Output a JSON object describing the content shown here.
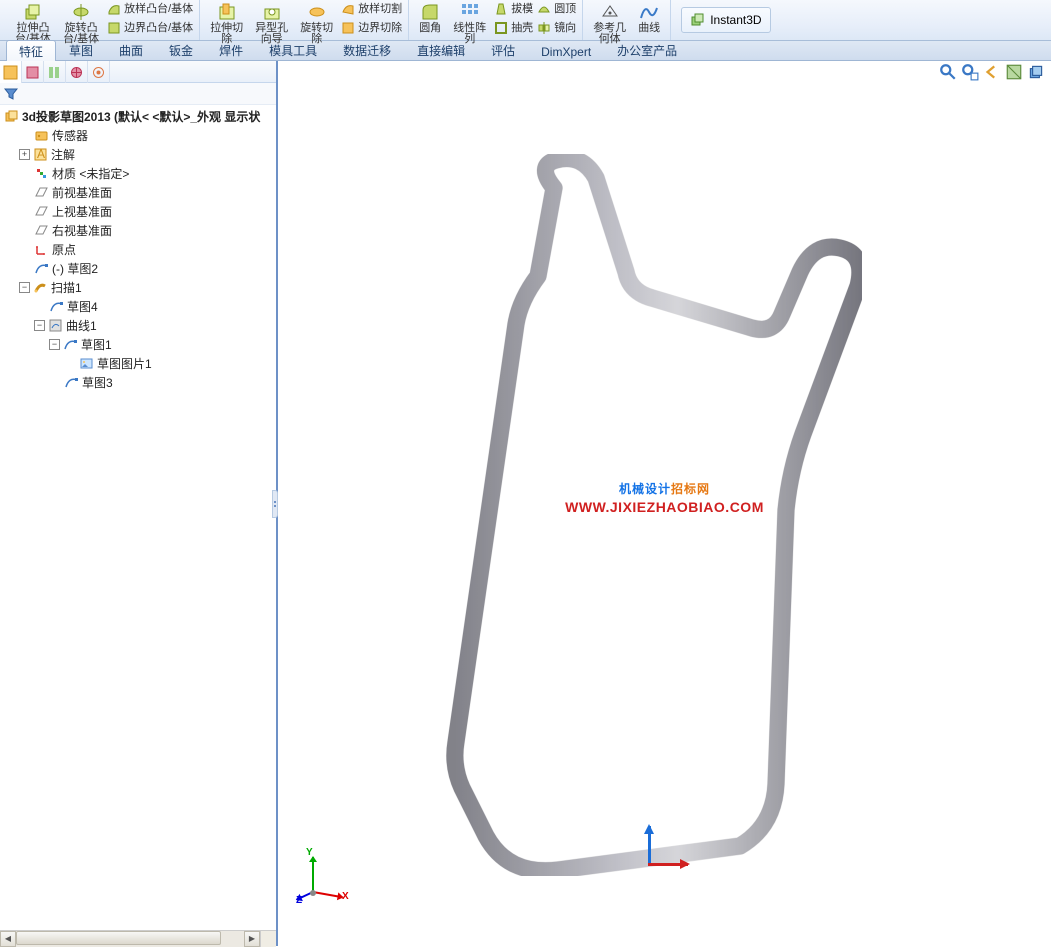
{
  "ribbon": {
    "groups": [
      {
        "buttons": [
          {
            "id": "extrude-boss",
            "label": "拉伸凸\n台/基体"
          },
          {
            "id": "revolve-boss",
            "label": "旋转凸\n台/基体"
          }
        ],
        "side": [
          {
            "id": "loft-boss",
            "label": "放样凸台/基体"
          },
          {
            "id": "boundary-boss",
            "label": "边界凸台/基体"
          }
        ]
      },
      {
        "buttons": [
          {
            "id": "extrude-cut",
            "label": "拉伸切\n除"
          },
          {
            "id": "hole-wizard",
            "label": "异型孔\n向导"
          },
          {
            "id": "revolve-cut",
            "label": "旋转切\n除"
          }
        ],
        "side": [
          {
            "id": "loft-cut",
            "label": "放样切割"
          },
          {
            "id": "boundary-cut",
            "label": "边界切除"
          }
        ]
      },
      {
        "buttons": [
          {
            "id": "fillet",
            "label": "圆角"
          },
          {
            "id": "linear-pattern",
            "label": "线性阵\n列"
          }
        ],
        "side": [
          {
            "id": "draft",
            "label": "拔模"
          },
          {
            "id": "shell",
            "label": "抽壳"
          },
          {
            "id": "dome",
            "label": "圆顶"
          },
          {
            "id": "mirror",
            "label": "镜向"
          }
        ]
      },
      {
        "buttons": [
          {
            "id": "ref-geom",
            "label": "参考几\n何体"
          },
          {
            "id": "curves",
            "label": "曲线"
          }
        ]
      },
      {
        "instant3d": "Instant3D"
      }
    ]
  },
  "tabs": [
    {
      "id": "features",
      "label": "特征",
      "active": true
    },
    {
      "id": "sketch",
      "label": "草图"
    },
    {
      "id": "surfaces",
      "label": "曲面"
    },
    {
      "id": "sheetmetal",
      "label": "钣金"
    },
    {
      "id": "weldments",
      "label": "焊件"
    },
    {
      "id": "moldtools",
      "label": "模具工具"
    },
    {
      "id": "migrate",
      "label": "数据迁移"
    },
    {
      "id": "directedit",
      "label": "直接编辑"
    },
    {
      "id": "evaluate",
      "label": "评估"
    },
    {
      "id": "dimxpert",
      "label": "DimXpert"
    },
    {
      "id": "office",
      "label": "办公室产品"
    }
  ],
  "tree": {
    "root": "3d投影草图2013  (默认< <默认>_外观 显示状",
    "items": [
      {
        "depth": 1,
        "ico": "sensor",
        "label": "传感器"
      },
      {
        "depth": 1,
        "ico": "annot",
        "exp": "+",
        "label": "注解"
      },
      {
        "depth": 1,
        "ico": "material",
        "label": "材质 <未指定>"
      },
      {
        "depth": 1,
        "ico": "plane",
        "label": "前视基准面"
      },
      {
        "depth": 1,
        "ico": "plane",
        "label": "上视基准面"
      },
      {
        "depth": 1,
        "ico": "plane",
        "label": "右视基准面"
      },
      {
        "depth": 1,
        "ico": "origin",
        "label": "原点"
      },
      {
        "depth": 1,
        "ico": "sketch",
        "label": "(-) 草图2"
      },
      {
        "depth": 1,
        "ico": "sweep",
        "exp": "-",
        "label": "扫描1"
      },
      {
        "depth": 2,
        "ico": "sketch",
        "label": "草图4"
      },
      {
        "depth": 2,
        "ico": "curve",
        "exp": "-",
        "label": "曲线1"
      },
      {
        "depth": 3,
        "ico": "sketch",
        "exp": "-",
        "label": "草图1"
      },
      {
        "depth": 4,
        "ico": "image",
        "label": "草图图片1"
      },
      {
        "depth": 3,
        "ico": "sketch",
        "label": "草图3"
      }
    ]
  },
  "watermark": {
    "line1a": "机械设计",
    "line1b": "招标网",
    "line2": "WWW.JIXIEZHAOBIAO.COM"
  },
  "triad": {
    "x": "X",
    "y": "Y",
    "z": "Z"
  }
}
